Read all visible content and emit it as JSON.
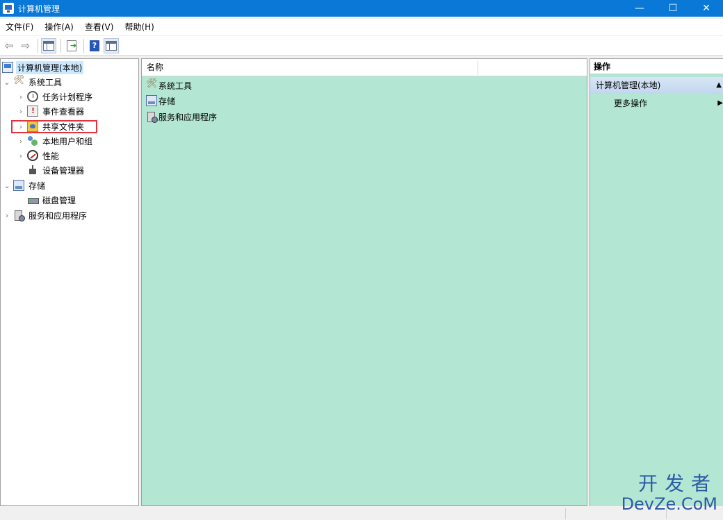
{
  "window": {
    "title": "计算机管理",
    "controls": {
      "minimize": "—",
      "maximize": "☐",
      "close": "✕"
    }
  },
  "menu": [
    "文件(F)",
    "操作(A)",
    "查看(V)",
    "帮助(H)"
  ],
  "toolbar": {
    "back": "⇦",
    "forward": "⇨"
  },
  "tree": {
    "root": {
      "label": "计算机管理(本地)",
      "expander": ""
    },
    "items": [
      {
        "label": "系统工具",
        "expander": "⌄"
      },
      {
        "label": "任务计划程序",
        "expander": "›"
      },
      {
        "label": "事件查看器",
        "expander": "›"
      },
      {
        "label": "共享文件夹",
        "expander": "›"
      },
      {
        "label": "本地用户和组",
        "expander": "›"
      },
      {
        "label": "性能",
        "expander": "›"
      },
      {
        "label": "设备管理器",
        "expander": ""
      },
      {
        "label": "存储",
        "expander": "⌄"
      },
      {
        "label": "磁盘管理",
        "expander": ""
      },
      {
        "label": "服务和应用程序",
        "expander": "›"
      }
    ]
  },
  "list": {
    "columns": [
      "名称",
      ""
    ],
    "rows": [
      "系统工具",
      "存储",
      "服务和应用程序"
    ]
  },
  "actions": {
    "header": "操作",
    "group": "计算机管理(本地)",
    "group_arrow": "▲",
    "item": "更多操作",
    "item_arrow": "▶"
  },
  "watermark": {
    "cn": "开发者",
    "en": "DevZe.CoM"
  },
  "colors": {
    "titlebar": "#0a78d7",
    "content_bg": "#b3e7d3",
    "highlight": "#e2343a"
  }
}
